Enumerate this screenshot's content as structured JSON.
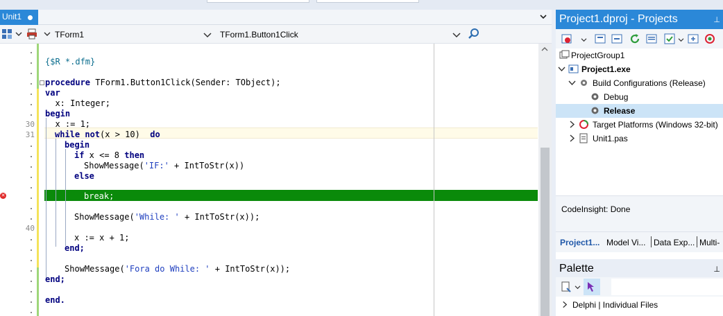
{
  "editor": {
    "tab_label": "Unit1",
    "class_combo": "TForm1",
    "method_combo": "TForm1.Button1Click",
    "line_numbers": [
      "30",
      "31",
      "40"
    ],
    "code": {
      "dfm": "{$R *.dfm}",
      "proc_kw": "procedure",
      "proc_rest": " TForm1.Button1Click(Sender: TObject);",
      "var_kw": "var",
      "decl": "  x: Integer;",
      "begin1": "begin",
      "assign1": "  x := 1;",
      "while_kw": "while",
      "while_not": "not",
      "while_cond": "(x > 10)  ",
      "do_kw": "do",
      "begin2": "begin",
      "if_kw": "if",
      "if_cond": " x <= 8 ",
      "then_kw": "then",
      "show1_a": "ShowMessage(",
      "show1_str": "'IF:'",
      "show1_b": " + IntToStr(x))",
      "else_kw": "else",
      "break_line": "break;",
      "show2_a": "ShowMessage(",
      "show2_str": "'While: '",
      "show2_b": " + IntToStr(x));",
      "assign2": "x := x + 1;",
      "end1": "end;",
      "show3_a": "ShowMessage(",
      "show3_str": "'Fora do While: '",
      "show3_b": " + IntToStr(x));",
      "end2": "end;",
      "end_final": "end."
    }
  },
  "projects": {
    "title": "Project1.dproj - Projects",
    "tree": [
      {
        "label": "ProjectGroup1"
      },
      {
        "label": "Project1.exe"
      },
      {
        "label": "Build Configurations (Release)"
      },
      {
        "label": "Debug"
      },
      {
        "label": "Release"
      },
      {
        "label": "Target Platforms (Windows 32-bit)"
      },
      {
        "label": "Unit1.pas"
      }
    ],
    "status": "CodeInsight: Done",
    "tabs": [
      "Project1...",
      "Model Vi...",
      "Data Exp...",
      "Multi-"
    ]
  },
  "palette": {
    "title": "Palette",
    "item": "Delphi | Individual Files"
  },
  "colors": {
    "accent": "#2b88d8",
    "breakpoint_line": "#0a8a0a",
    "keyword": "#00007f",
    "string": "#1f3fbf"
  }
}
